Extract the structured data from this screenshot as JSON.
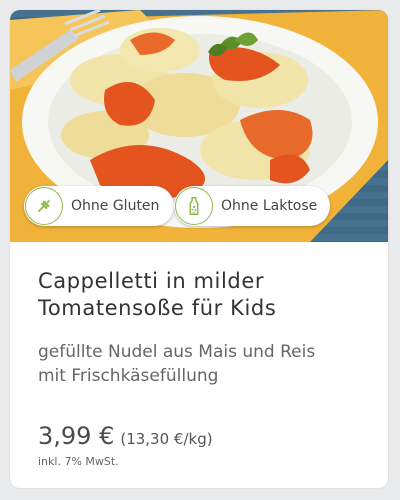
{
  "product": {
    "badges": [
      {
        "label": "Ohne Gluten",
        "icon": "wheat-icon"
      },
      {
        "label": "Ohne Laktose",
        "icon": "milk-bottle-icon"
      }
    ],
    "title_line1": "Cappelletti in milder",
    "title_line2": "Tomatensoße für Kids",
    "desc_line1": "gefüllte Nudel aus Mais und Reis",
    "desc_line2": "mit Frischkäsefüllung",
    "price": "3,99 €",
    "unit_price": "(13,30 €/kg)",
    "vat_note": "inkl. 7% MwSt."
  },
  "colors": {
    "badge_icon": "#8fb84c",
    "sauce": "#e3541f",
    "pasta": "#f1e4a8",
    "napkin": "#f1b23a",
    "table": "#3f6a86"
  }
}
